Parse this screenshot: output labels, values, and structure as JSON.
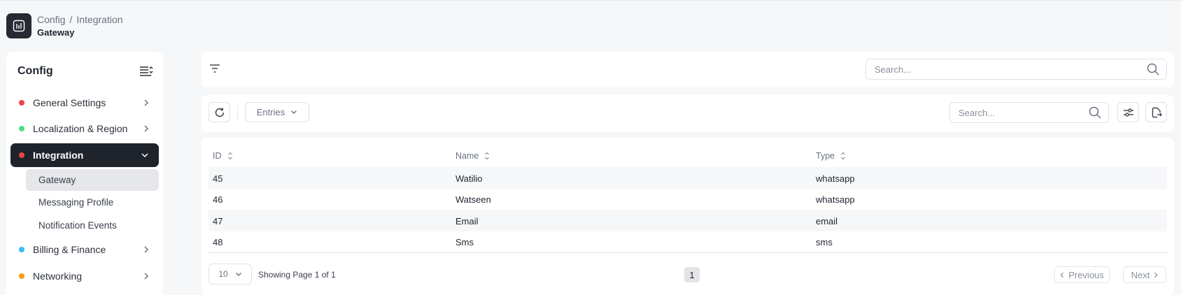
{
  "breadcrumb": {
    "root": "Config",
    "separator": "/",
    "current": "Integration",
    "page": "Gateway"
  },
  "sidebar": {
    "title": "Config",
    "items": [
      {
        "label": "General Settings",
        "color": "#ef4444"
      },
      {
        "label": "Localization & Region",
        "color": "#4ade80"
      },
      {
        "label": "Integration",
        "color": "#ef4444"
      },
      {
        "label": "Billing & Finance",
        "color": "#38bdf8"
      },
      {
        "label": "Networking",
        "color": "#f59e0b"
      }
    ],
    "subitems": [
      {
        "label": "Gateway"
      },
      {
        "label": "Messaging Profile"
      },
      {
        "label": "Notification Events"
      }
    ]
  },
  "filterbar": {
    "search_placeholder": "Search..."
  },
  "toolbar": {
    "entries_label": "Entries",
    "search_placeholder": "Search..."
  },
  "table": {
    "columns": [
      "ID",
      "Name",
      "Type"
    ],
    "rows": [
      [
        "45",
        "Watilio",
        "whatsapp"
      ],
      [
        "46",
        "Watseen",
        "whatsapp"
      ],
      [
        "47",
        "Email",
        "email"
      ],
      [
        "48",
        "Sms",
        "sms"
      ]
    ]
  },
  "pagination": {
    "page_size": "10",
    "showing": "Showing Page 1 of 1",
    "current_page": "1",
    "previous": "Previous",
    "next": "Next"
  }
}
